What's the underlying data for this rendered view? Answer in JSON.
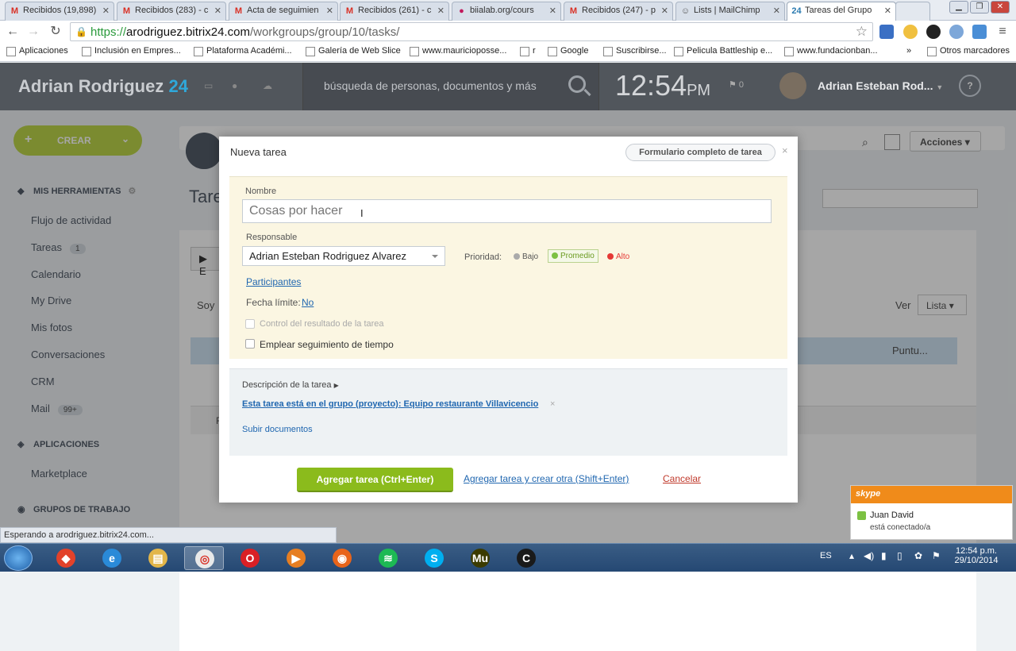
{
  "browser": {
    "tabs": [
      {
        "label": "Recibidos (19,898)",
        "icon": "gmail-icon",
        "fav": "M",
        "color": "#d93025"
      },
      {
        "label": "Recibidos (283) - c",
        "icon": "gmail-icon",
        "fav": "M",
        "color": "#d93025"
      },
      {
        "label": "Acta de seguimien",
        "icon": "gmail-icon",
        "fav": "M",
        "color": "#d93025"
      },
      {
        "label": "Recibidos (261) - c",
        "icon": "gmail-icon",
        "fav": "M",
        "color": "#d93025"
      },
      {
        "label": "biialab.org/cours",
        "icon": "biialab-icon",
        "fav": "●",
        "color": "#c2185b"
      },
      {
        "label": "Recibidos (247) - p",
        "icon": "gmail-icon",
        "fav": "M",
        "color": "#d93025"
      },
      {
        "label": "Lists | MailChimp",
        "icon": "mailchimp-icon",
        "fav": "☺",
        "color": "#555"
      },
      {
        "label": "Tareas del Grupo",
        "icon": "bitrix24-icon",
        "fav": "24",
        "color": "#2a7ab0"
      }
    ],
    "url": {
      "scheme": "https://",
      "host": "arodriguez.bitrix24.com",
      "path": "/workgroups/group/10/tasks/"
    },
    "bookmarks": [
      "Aplicaciones",
      "Inclusión en Empres...",
      "Plataforma Académi...",
      "Galería de Web Slice",
      "www.mauricioposse...",
      "r",
      "Google",
      "Suscribirse...",
      "Pelicula Battleship e...",
      "www.fundacionban...",
      "»",
      "Otros marcadores"
    ],
    "status": "Esperando a arodriguez.bitrix24.com..."
  },
  "header": {
    "logo_name": "Adrian Rodriguez",
    "logo_num": "24",
    "search_placeholder": "búsqueda de personas, documentos y más",
    "time": "12:54",
    "ampm": "PM",
    "flag_count": "0",
    "user_name": "Adrian Esteban Rod...",
    "help": "?"
  },
  "sidebar": {
    "create": "CREAR",
    "tools_heading": "MIS HERRAMIENTAS",
    "items": [
      {
        "label": "Flujo de actividad",
        "count": ""
      },
      {
        "label": "Tareas",
        "count": "1"
      },
      {
        "label": "Calendario",
        "count": ""
      },
      {
        "label": "My Drive",
        "count": ""
      },
      {
        "label": "Mis fotos",
        "count": ""
      },
      {
        "label": "Conversaciones",
        "count": ""
      },
      {
        "label": "CRM",
        "count": ""
      },
      {
        "label": "Mail",
        "count": "99+"
      }
    ],
    "apps_heading": "APLICACIONES",
    "apps_items": [
      {
        "label": "Marketplace"
      }
    ],
    "groups_heading": "GRUPOS DE TRABAJO"
  },
  "background_page": {
    "title_partial": "Tare",
    "actions": "Acciones",
    "view_label": "Ver",
    "view_value": "Lista",
    "soy": "Soy",
    "puntu": "Puntu...",
    "e_partial": "E",
    "f_partial": "F"
  },
  "modal": {
    "title": "Nueva tarea",
    "full_form": "Formulario completo de tarea",
    "name_label": "Nombre",
    "name_placeholder": "Cosas por hacer",
    "responsible_label": "Responsable",
    "responsible_value": "Adrian Esteban Rodriguez Alvarez",
    "priority_label": "Prioridad:",
    "priority_low": "Bajo",
    "priority_medium": "Promedio",
    "priority_high": "Alto",
    "priority_selected": "Promedio",
    "participants": "Participantes",
    "deadline_label": "Fecha límite:",
    "deadline_value": "No",
    "control_label": "Control del resultado de la tarea",
    "time_tracking_label": "Emplear seguimiento de tiempo",
    "description_label": "Descripción de la tarea",
    "group_link": "Esta tarea está en el grupo (proyecto): Equipo restaurante Villavicencio",
    "upload": "Subir documentos",
    "add_button": "Agregar tarea (Ctrl+Enter)",
    "add_another": "Agregar tarea y crear otra (Shift+Enter)",
    "cancel": "Cancelar"
  },
  "skype": {
    "brand": "skype",
    "contact": "Juan David",
    "status": "está conectado/a"
  },
  "taskbar": {
    "apps": [
      "opera-icon",
      "ie-icon",
      "explorer-icon",
      "chrome-icon",
      "opera-red-icon",
      "media-player-icon",
      "firefox-icon",
      "spotify-icon",
      "skype-icon",
      "muse-icon",
      "camtasia-icon"
    ],
    "lang": "ES",
    "time": "12:54 p.m.",
    "date": "29/10/2014"
  },
  "colors": {
    "bitrix_header": "#51565c",
    "accent_blue": "#2fa8da",
    "create_green": "#bdd64a",
    "add_green": "#8bbb1c",
    "cancel_red": "#c0392b"
  }
}
